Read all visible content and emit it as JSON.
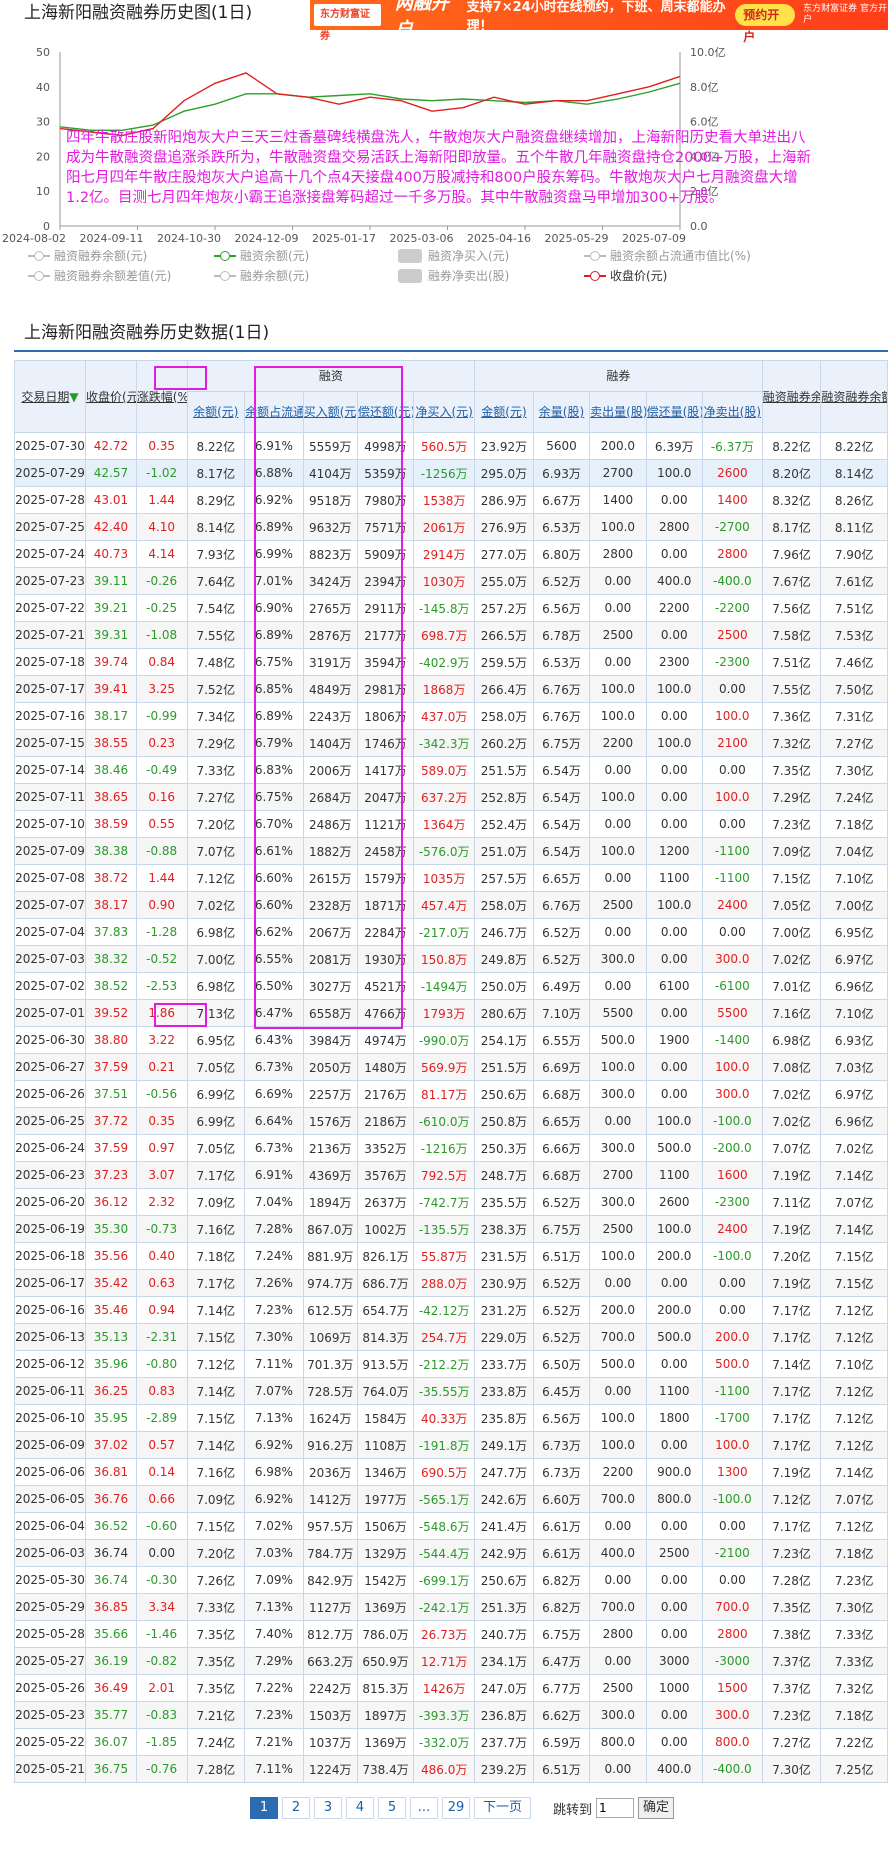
{
  "page": {
    "title": "上海新阳融资融券历史图(1日)",
    "table_title": "上海新阳融资融券历史数据(1日)"
  },
  "ad": {
    "brand": "东方财富证券",
    "headline": "两融开户",
    "message": "支持7×24小时在线预约，下班、周末都能办理！",
    "cta": "预约开户",
    "fine_print": "东方财富证券 官方开户"
  },
  "chart_data": {
    "type": "line",
    "x_ticks": [
      "2024-08-02",
      "2024-09-11",
      "2024-10-30",
      "2024-12-09",
      "2025-01-17",
      "2025-03-06",
      "2025-04-16",
      "2025-05-29",
      "2025-07-09"
    ],
    "y_left_ticks": [
      "0",
      "10",
      "20",
      "30",
      "40",
      "50"
    ],
    "y_right_ticks": [
      "0.0",
      "2.0亿",
      "4.0亿",
      "6.0亿",
      "8.0亿",
      "10.0亿"
    ],
    "ylim_left": [
      0,
      50
    ],
    "ylim_right": [
      0,
      10
    ],
    "series": [
      {
        "name": "融资余额(元)",
        "color": "#2ca02c",
        "axis": "right",
        "x": [
          0,
          5,
          10,
          15,
          20,
          25,
          30,
          35,
          40,
          45,
          50,
          55,
          60,
          65,
          70,
          75,
          80,
          85,
          90,
          95,
          100
        ],
        "values": [
          5.7,
          5.5,
          5.5,
          5.8,
          6.6,
          7.0,
          7.6,
          7.6,
          7.4,
          7.5,
          7.6,
          7.3,
          7.2,
          7.3,
          7.2,
          7.1,
          7.2,
          7.0,
          7.3,
          7.7,
          8.2
        ]
      },
      {
        "name": "收盘价(元)",
        "color": "#e02020",
        "axis": "left",
        "x": [
          0,
          5,
          10,
          15,
          20,
          25,
          30,
          35,
          40,
          45,
          50,
          55,
          60,
          65,
          70,
          75,
          80,
          85,
          90,
          95,
          100
        ],
        "values": [
          28,
          27,
          26,
          28,
          36,
          41,
          44,
          38,
          37,
          35,
          37,
          36,
          33,
          34,
          37,
          35,
          36,
          36,
          38,
          40,
          43
        ]
      }
    ],
    "annotation": "四年牛散庄股新阳炮灰大户三天三炷香墓碑线横盘洗人，牛散炮灰大户融资盘继续增加，上海新阳历史看大单进出八成为牛散融资盘追涨杀跌所为，牛散融资盘交易活跃上海新阳即放量。五个牛散几年融资盘持仓2000+万股，上海新阳七月四年牛散庄股炮灰大户追高十几个点4天接盘400万股减持和800户股东筹码。牛散炮灰大户七月融资盘大增1.2亿。目测七月四年炮灰小霸王追涨接盘筹码超过一千多万股。其中牛散融资盘马甲增加300+万股。"
  },
  "legend": [
    {
      "label": "融资融券余额(元)",
      "kind": "line",
      "color": "#bbbbbb"
    },
    {
      "label": "融资余额(元)",
      "kind": "line",
      "color": "#2ca02c"
    },
    {
      "label": "融资净买入(元)",
      "kind": "block",
      "color": "#cccccc"
    },
    {
      "label": "融资余额占流通市值比(%)",
      "kind": "line",
      "color": "#bbbbbb"
    },
    {
      "label": "融资融券余额差值(元)",
      "kind": "line",
      "color": "#bbbbbb"
    },
    {
      "label": "融券余额(元)",
      "kind": "line",
      "color": "#bbbbbb"
    },
    {
      "label": "融券净卖出(股)",
      "kind": "block",
      "color": "#cccccc"
    },
    {
      "label": "收盘价(元)",
      "kind": "line",
      "color": "#e02020"
    }
  ],
  "table": {
    "group_headers": [
      "融资",
      "融券"
    ],
    "headers": [
      "交易日期",
      "收盘价(元)",
      "涨跌幅(%)",
      "余额(元)",
      "余额占流通市值比",
      "买入额(元)",
      "偿还额(元)",
      "净买入(元)",
      "金额(元)",
      "余量(股)",
      "卖出量(股)",
      "偿还量(股)",
      "净卖出(股)",
      "融资融券余额(元)",
      "融资融券余额差值(元)"
    ],
    "rows": [
      [
        "2025-07-30",
        "42.72",
        "0.35",
        "8.22亿",
        "6.91%",
        "5559万",
        "4998万",
        "560.5万",
        "23.92万",
        "5600",
        "200.0",
        "6.39万",
        "-6.37万",
        "8.22亿",
        "8.22亿"
      ],
      [
        "2025-07-29",
        "42.57",
        "-1.02",
        "8.17亿",
        "6.88%",
        "4104万",
        "5359万",
        "-1256万",
        "295.0万",
        "6.93万",
        "2700",
        "100.0",
        "2600",
        "8.20亿",
        "8.14亿"
      ],
      [
        "2025-07-28",
        "43.01",
        "1.44",
        "8.29亿",
        "6.92%",
        "9518万",
        "7980万",
        "1538万",
        "286.9万",
        "6.67万",
        "1400",
        "0.00",
        "1400",
        "8.32亿",
        "8.26亿"
      ],
      [
        "2025-07-25",
        "42.40",
        "4.10",
        "8.14亿",
        "6.89%",
        "9632万",
        "7571万",
        "2061万",
        "276.9万",
        "6.53万",
        "100.0",
        "2800",
        "-2700",
        "8.17亿",
        "8.11亿"
      ],
      [
        "2025-07-24",
        "40.73",
        "4.14",
        "7.93亿",
        "6.99%",
        "8823万",
        "5909万",
        "2914万",
        "277.0万",
        "6.80万",
        "2800",
        "0.00",
        "2800",
        "7.96亿",
        "7.90亿"
      ],
      [
        "2025-07-23",
        "39.11",
        "-0.26",
        "7.64亿",
        "7.01%",
        "3424万",
        "2394万",
        "1030万",
        "255.0万",
        "6.52万",
        "0.00",
        "400.0",
        "-400.0",
        "7.67亿",
        "7.61亿"
      ],
      [
        "2025-07-22",
        "39.21",
        "-0.25",
        "7.54亿",
        "6.90%",
        "2765万",
        "2911万",
        "-145.8万",
        "257.2万",
        "6.56万",
        "0.00",
        "2200",
        "-2200",
        "7.56亿",
        "7.51亿"
      ],
      [
        "2025-07-21",
        "39.31",
        "-1.08",
        "7.55亿",
        "6.89%",
        "2876万",
        "2177万",
        "698.7万",
        "266.5万",
        "6.78万",
        "2500",
        "0.00",
        "2500",
        "7.58亿",
        "7.53亿"
      ],
      [
        "2025-07-18",
        "39.74",
        "0.84",
        "7.48亿",
        "6.75%",
        "3191万",
        "3594万",
        "-402.9万",
        "259.5万",
        "6.53万",
        "0.00",
        "2300",
        "-2300",
        "7.51亿",
        "7.46亿"
      ],
      [
        "2025-07-17",
        "39.41",
        "3.25",
        "7.52亿",
        "6.85%",
        "4849万",
        "2981万",
        "1868万",
        "266.4万",
        "6.76万",
        "100.0",
        "100.0",
        "0.00",
        "7.55亿",
        "7.50亿"
      ],
      [
        "2025-07-16",
        "38.17",
        "-0.99",
        "7.34亿",
        "6.89%",
        "2243万",
        "1806万",
        "437.0万",
        "258.0万",
        "6.76万",
        "100.0",
        "0.00",
        "100.0",
        "7.36亿",
        "7.31亿"
      ],
      [
        "2025-07-15",
        "38.55",
        "0.23",
        "7.29亿",
        "6.79%",
        "1404万",
        "1746万",
        "-342.3万",
        "260.2万",
        "6.75万",
        "2200",
        "100.0",
        "2100",
        "7.32亿",
        "7.27亿"
      ],
      [
        "2025-07-14",
        "38.46",
        "-0.49",
        "7.33亿",
        "6.83%",
        "2006万",
        "1417万",
        "589.0万",
        "251.5万",
        "6.54万",
        "0.00",
        "0.00",
        "0.00",
        "7.35亿",
        "7.30亿"
      ],
      [
        "2025-07-11",
        "38.65",
        "0.16",
        "7.27亿",
        "6.75%",
        "2684万",
        "2047万",
        "637.2万",
        "252.8万",
        "6.54万",
        "100.0",
        "0.00",
        "100.0",
        "7.29亿",
        "7.24亿"
      ],
      [
        "2025-07-10",
        "38.59",
        "0.55",
        "7.20亿",
        "6.70%",
        "2486万",
        "1121万",
        "1364万",
        "252.4万",
        "6.54万",
        "0.00",
        "0.00",
        "0.00",
        "7.23亿",
        "7.18亿"
      ],
      [
        "2025-07-09",
        "38.38",
        "-0.88",
        "7.07亿",
        "6.61%",
        "1882万",
        "2458万",
        "-576.0万",
        "251.0万",
        "6.54万",
        "100.0",
        "1200",
        "-1100",
        "7.09亿",
        "7.04亿"
      ],
      [
        "2025-07-08",
        "38.72",
        "1.44",
        "7.12亿",
        "6.60%",
        "2615万",
        "1579万",
        "1035万",
        "257.5万",
        "6.65万",
        "0.00",
        "1100",
        "-1100",
        "7.15亿",
        "7.10亿"
      ],
      [
        "2025-07-07",
        "38.17",
        "0.90",
        "7.02亿",
        "6.60%",
        "2328万",
        "1871万",
        "457.4万",
        "258.0万",
        "6.76万",
        "2500",
        "100.0",
        "2400",
        "7.05亿",
        "7.00亿"
      ],
      [
        "2025-07-04",
        "37.83",
        "-1.28",
        "6.98亿",
        "6.62%",
        "2067万",
        "2284万",
        "-217.0万",
        "246.7万",
        "6.52万",
        "0.00",
        "0.00",
        "0.00",
        "7.00亿",
        "6.95亿"
      ],
      [
        "2025-07-03",
        "38.32",
        "-0.52",
        "7.00亿",
        "6.55%",
        "2081万",
        "1930万",
        "150.8万",
        "249.8万",
        "6.52万",
        "300.0",
        "0.00",
        "300.0",
        "7.02亿",
        "6.97亿"
      ],
      [
        "2025-07-02",
        "38.52",
        "-2.53",
        "6.98亿",
        "6.50%",
        "3027万",
        "4521万",
        "-1494万",
        "250.0万",
        "6.49万",
        "0.00",
        "6100",
        "-6100",
        "7.01亿",
        "6.96亿"
      ],
      [
        "2025-07-01",
        "39.52",
        "1.86",
        "7.13亿",
        "6.47%",
        "6558万",
        "4766万",
        "1793万",
        "280.6万",
        "7.10万",
        "5500",
        "0.00",
        "5500",
        "7.16亿",
        "7.10亿"
      ],
      [
        "2025-06-30",
        "38.80",
        "3.22",
        "6.95亿",
        "6.43%",
        "3984万",
        "4974万",
        "-990.0万",
        "254.1万",
        "6.55万",
        "500.0",
        "1900",
        "-1400",
        "6.98亿",
        "6.93亿"
      ],
      [
        "2025-06-27",
        "37.59",
        "0.21",
        "7.05亿",
        "6.73%",
        "2050万",
        "1480万",
        "569.9万",
        "251.5万",
        "6.69万",
        "100.0",
        "0.00",
        "100.0",
        "7.08亿",
        "7.03亿"
      ],
      [
        "2025-06-26",
        "37.51",
        "-0.56",
        "6.99亿",
        "6.69%",
        "2257万",
        "2176万",
        "81.17万",
        "250.6万",
        "6.68万",
        "300.0",
        "0.00",
        "300.0",
        "7.02亿",
        "6.97亿"
      ],
      [
        "2025-06-25",
        "37.72",
        "0.35",
        "6.99亿",
        "6.64%",
        "1576万",
        "2186万",
        "-610.0万",
        "250.8万",
        "6.65万",
        "0.00",
        "100.0",
        "-100.0",
        "7.02亿",
        "6.96亿"
      ],
      [
        "2025-06-24",
        "37.59",
        "0.97",
        "7.05亿",
        "6.73%",
        "2136万",
        "3352万",
        "-1216万",
        "250.3万",
        "6.66万",
        "300.0",
        "500.0",
        "-200.0",
        "7.07亿",
        "7.02亿"
      ],
      [
        "2025-06-23",
        "37.23",
        "3.07",
        "7.17亿",
        "6.91%",
        "4369万",
        "3576万",
        "792.5万",
        "248.7万",
        "6.68万",
        "2700",
        "1100",
        "1600",
        "7.19亿",
        "7.14亿"
      ],
      [
        "2025-06-20",
        "36.12",
        "2.32",
        "7.09亿",
        "7.04%",
        "1894万",
        "2637万",
        "-742.7万",
        "235.5万",
        "6.52万",
        "300.0",
        "2600",
        "-2300",
        "7.11亿",
        "7.07亿"
      ],
      [
        "2025-06-19",
        "35.30",
        "-0.73",
        "7.16亿",
        "7.28%",
        "867.0万",
        "1002万",
        "-135.5万",
        "238.3万",
        "6.75万",
        "2500",
        "100.0",
        "2400",
        "7.19亿",
        "7.14亿"
      ],
      [
        "2025-06-18",
        "35.56",
        "0.40",
        "7.18亿",
        "7.24%",
        "881.9万",
        "826.1万",
        "55.87万",
        "231.5万",
        "6.51万",
        "100.0",
        "200.0",
        "-100.0",
        "7.20亿",
        "7.15亿"
      ],
      [
        "2025-06-17",
        "35.42",
        "0.63",
        "7.17亿",
        "7.26%",
        "974.7万",
        "686.7万",
        "288.0万",
        "230.9万",
        "6.52万",
        "0.00",
        "0.00",
        "0.00",
        "7.19亿",
        "7.15亿"
      ],
      [
        "2025-06-16",
        "35.46",
        "0.94",
        "7.14亿",
        "7.23%",
        "612.5万",
        "654.7万",
        "-42.12万",
        "231.2万",
        "6.52万",
        "200.0",
        "200.0",
        "0.00",
        "7.17亿",
        "7.12亿"
      ],
      [
        "2025-06-13",
        "35.13",
        "-2.31",
        "7.15亿",
        "7.30%",
        "1069万",
        "814.3万",
        "254.7万",
        "229.0万",
        "6.52万",
        "700.0",
        "500.0",
        "200.0",
        "7.17亿",
        "7.12亿"
      ],
      [
        "2025-06-12",
        "35.96",
        "-0.80",
        "7.12亿",
        "7.11%",
        "701.3万",
        "913.5万",
        "-212.2万",
        "233.7万",
        "6.50万",
        "500.0",
        "0.00",
        "500.0",
        "7.14亿",
        "7.10亿"
      ],
      [
        "2025-06-11",
        "36.25",
        "0.83",
        "7.14亿",
        "7.07%",
        "728.5万",
        "764.0万",
        "-35.55万",
        "233.8万",
        "6.45万",
        "0.00",
        "1100",
        "-1100",
        "7.17亿",
        "7.12亿"
      ],
      [
        "2025-06-10",
        "35.95",
        "-2.89",
        "7.15亿",
        "7.13%",
        "1624万",
        "1584万",
        "40.33万",
        "235.8万",
        "6.56万",
        "100.0",
        "1800",
        "-1700",
        "7.17亿",
        "7.12亿"
      ],
      [
        "2025-06-09",
        "37.02",
        "0.57",
        "7.14亿",
        "6.92%",
        "916.2万",
        "1108万",
        "-191.8万",
        "249.1万",
        "6.73万",
        "100.0",
        "0.00",
        "100.0",
        "7.17亿",
        "7.12亿"
      ],
      [
        "2025-06-06",
        "36.81",
        "0.14",
        "7.16亿",
        "6.98%",
        "2036万",
        "1346万",
        "690.5万",
        "247.7万",
        "6.73万",
        "2200",
        "900.0",
        "1300",
        "7.19亿",
        "7.14亿"
      ],
      [
        "2025-06-05",
        "36.76",
        "0.66",
        "7.09亿",
        "6.92%",
        "1412万",
        "1977万",
        "-565.1万",
        "242.6万",
        "6.60万",
        "700.0",
        "800.0",
        "-100.0",
        "7.12亿",
        "7.07亿"
      ],
      [
        "2025-06-04",
        "36.52",
        "-0.60",
        "7.15亿",
        "7.02%",
        "957.5万",
        "1506万",
        "-548.6万",
        "241.4万",
        "6.61万",
        "0.00",
        "0.00",
        "0.00",
        "7.17亿",
        "7.12亿"
      ],
      [
        "2025-06-03",
        "36.74",
        "0.00",
        "7.20亿",
        "7.03%",
        "784.7万",
        "1329万",
        "-544.4万",
        "242.9万",
        "6.61万",
        "400.0",
        "2500",
        "-2100",
        "7.23亿",
        "7.18亿"
      ],
      [
        "2025-05-30",
        "36.74",
        "-0.30",
        "7.26亿",
        "7.09%",
        "842.9万",
        "1542万",
        "-699.1万",
        "250.6万",
        "6.82万",
        "0.00",
        "0.00",
        "0.00",
        "7.28亿",
        "7.23亿"
      ],
      [
        "2025-05-29",
        "36.85",
        "3.34",
        "7.33亿",
        "7.13%",
        "1127万",
        "1369万",
        "-242.1万",
        "251.3万",
        "6.82万",
        "700.0",
        "0.00",
        "700.0",
        "7.35亿",
        "7.30亿"
      ],
      [
        "2025-05-28",
        "35.66",
        "-1.46",
        "7.35亿",
        "7.40%",
        "812.7万",
        "786.0万",
        "26.73万",
        "240.7万",
        "6.75万",
        "2800",
        "0.00",
        "2800",
        "7.38亿",
        "7.33亿"
      ],
      [
        "2025-05-27",
        "36.19",
        "-0.82",
        "7.35亿",
        "7.29%",
        "663.2万",
        "650.9万",
        "12.71万",
        "234.1万",
        "6.47万",
        "0.00",
        "3000",
        "-3000",
        "7.37亿",
        "7.33亿"
      ],
      [
        "2025-05-26",
        "36.49",
        "2.01",
        "7.35亿",
        "7.22%",
        "2242万",
        "815.3万",
        "1426万",
        "247.0万",
        "6.77万",
        "2500",
        "1000",
        "1500",
        "7.37亿",
        "7.32亿"
      ],
      [
        "2025-05-23",
        "35.77",
        "-0.83",
        "7.21亿",
        "7.23%",
        "1503万",
        "1897万",
        "-393.3万",
        "236.8万",
        "6.62万",
        "300.0",
        "0.00",
        "300.0",
        "7.23亿",
        "7.18亿"
      ],
      [
        "2025-05-22",
        "36.07",
        "-1.85",
        "7.24亿",
        "7.21%",
        "1037万",
        "1369万",
        "-332.0万",
        "237.7万",
        "6.59万",
        "800.0",
        "0.00",
        "800.0",
        "7.27亿",
        "7.22亿"
      ],
      [
        "2025-05-21",
        "36.75",
        "-0.76",
        "7.28亿",
        "7.11%",
        "1224万",
        "738.4万",
        "486.0万",
        "239.2万",
        "6.51万",
        "0.00",
        "400.0",
        "-400.0",
        "7.30亿",
        "7.25亿"
      ]
    ]
  },
  "pager": {
    "pages": [
      "1",
      "2",
      "3",
      "4",
      "5",
      "...",
      "29"
    ],
    "next": "下一页",
    "jump_label": "跳转到",
    "jump_value": "1",
    "go": "确定"
  }
}
